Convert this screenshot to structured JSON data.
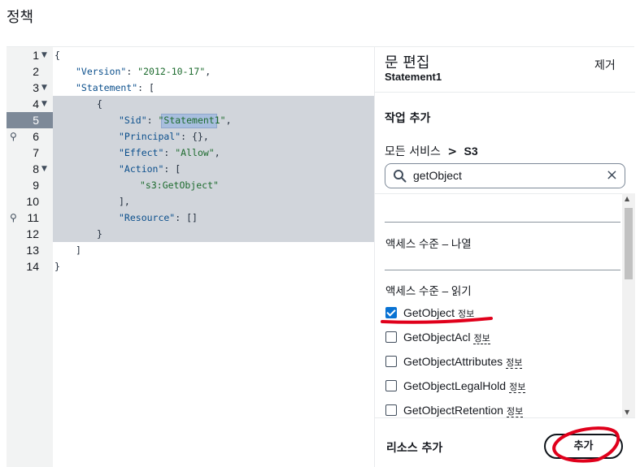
{
  "page": {
    "title": "정책"
  },
  "editor": {
    "lines": [
      {
        "n": "1",
        "fold": true,
        "bulb": false,
        "active": false
      },
      {
        "n": "2",
        "fold": false,
        "bulb": false,
        "active": false
      },
      {
        "n": "3",
        "fold": true,
        "bulb": false,
        "active": false
      },
      {
        "n": "4",
        "fold": true,
        "bulb": false,
        "active": false
      },
      {
        "n": "5",
        "fold": false,
        "bulb": false,
        "active": true
      },
      {
        "n": "6",
        "fold": false,
        "bulb": true,
        "active": false
      },
      {
        "n": "7",
        "fold": false,
        "bulb": false,
        "active": false
      },
      {
        "n": "8",
        "fold": true,
        "bulb": false,
        "active": false
      },
      {
        "n": "9",
        "fold": false,
        "bulb": false,
        "active": false
      },
      {
        "n": "10",
        "fold": false,
        "bulb": false,
        "active": false
      },
      {
        "n": "11",
        "fold": false,
        "bulb": true,
        "active": false
      },
      {
        "n": "12",
        "fold": false,
        "bulb": false,
        "active": false
      },
      {
        "n": "13",
        "fold": false,
        "bulb": false,
        "active": false
      },
      {
        "n": "14",
        "fold": false,
        "bulb": false,
        "active": false
      }
    ],
    "code": {
      "l1": "{",
      "l2_key": "\"Version\"",
      "l2_val": "\"2012-10-17\"",
      "l3_key": "\"Statement\"",
      "l3_rest": ": [",
      "l4": "{",
      "l5_key": "\"Sid\"",
      "l5_val": "\"Statement1\"",
      "l6_key": "\"Principal\"",
      "l6_rest": ": {},",
      "l7_key": "\"Effect\"",
      "l7_val": "\"Allow\"",
      "l8_key": "\"Action\"",
      "l8_rest": ": [",
      "l9_val": "\"s3:GetObject\"",
      "l10": "],",
      "l11_key": "\"Resource\"",
      "l11_rest": ": []",
      "l12": "}",
      "l13": "]",
      "l14": "}"
    }
  },
  "panel": {
    "title": "문 편집",
    "subtitle": "Statement1",
    "remove_label": "제거",
    "add_action_label": "작업 추가",
    "breadcrumb": {
      "root": "모든 서비스",
      "separator": ">",
      "current": "S3"
    },
    "search": {
      "value": "getObject",
      "clear_icon": "×"
    },
    "groups": {
      "list_label": "액세스 수준 – 나열",
      "read_label": "액세스 수준 – 읽기"
    },
    "actions": [
      {
        "name": "GetObject",
        "info": "정보",
        "checked": true
      },
      {
        "name": "GetObjectAcl",
        "info": "정보",
        "checked": false
      },
      {
        "name": "GetObjectAttributes",
        "info": "정보",
        "checked": false
      },
      {
        "name": "GetObjectLegalHold",
        "info": "정보",
        "checked": false
      },
      {
        "name": "GetObjectRetention",
        "info": "정보",
        "checked": false
      }
    ],
    "add_resource_label": "리소스 추가",
    "add_button_label": "추가"
  },
  "colors": {
    "accent": "#0972d3",
    "annotation": "#e0001b",
    "selection": "#d1d5db"
  }
}
